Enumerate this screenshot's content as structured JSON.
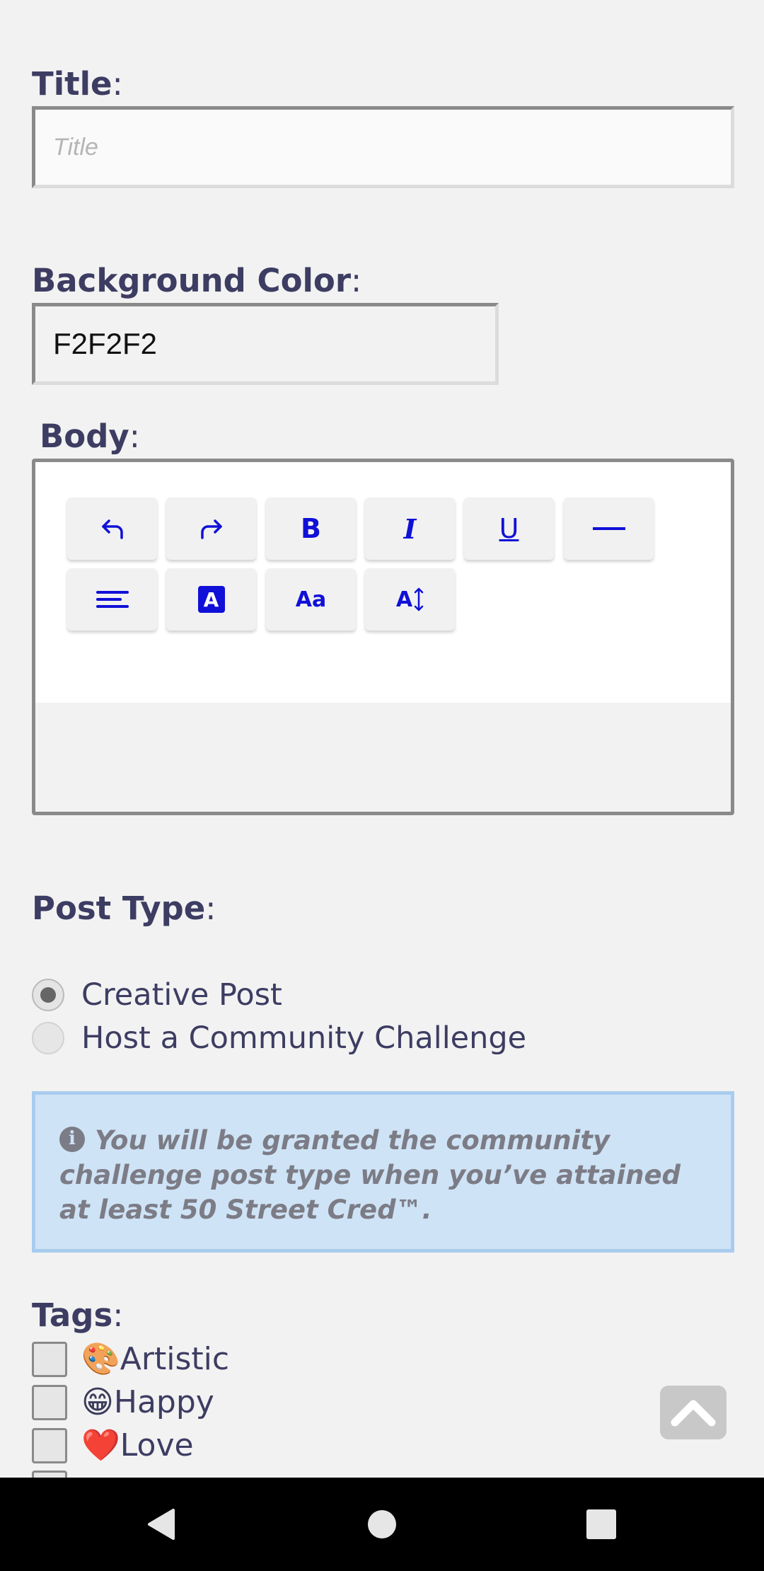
{
  "form": {
    "title_label": "Title",
    "title_placeholder": "Title",
    "title_value": "",
    "bgcolor_label": "Background Color",
    "bgcolor_value": "F2F2F2",
    "body_label": "Body",
    "colon": ":"
  },
  "editor": {
    "toolbar": [
      {
        "name": "undo-icon",
        "label": ""
      },
      {
        "name": "redo-icon",
        "label": ""
      },
      {
        "name": "bold-icon",
        "label": "B"
      },
      {
        "name": "italic-icon",
        "label": "I"
      },
      {
        "name": "underline-icon",
        "label": "U"
      },
      {
        "name": "horizontal-rule-icon",
        "label": ""
      },
      {
        "name": "align-left-icon",
        "label": ""
      },
      {
        "name": "text-color-icon",
        "label": "A"
      },
      {
        "name": "font-size-icon",
        "label": "Aa"
      },
      {
        "name": "line-height-icon",
        "label": "A"
      }
    ],
    "accent": "#1010d8"
  },
  "post_type": {
    "label": "Post Type",
    "options": [
      {
        "label": "Creative Post",
        "checked": true
      },
      {
        "label": "Host a Community Challenge",
        "checked": false
      }
    ]
  },
  "info": {
    "icon": "info-icon",
    "text": "You will be granted the community challenge post type when you’ve attained at least 50 Street Cred™."
  },
  "tags": {
    "label": "Tags",
    "items": [
      {
        "emoji": "🎨",
        "label": "Artistic"
      },
      {
        "emoji": "😁",
        "label": "Happy"
      },
      {
        "emoji": "❤️",
        "label": "Love"
      }
    ]
  },
  "colors": {
    "background": "#f2f2f2",
    "label": "#3d3d63",
    "info_bg": "#cfe3f6",
    "info_border": "#a8ccee"
  }
}
